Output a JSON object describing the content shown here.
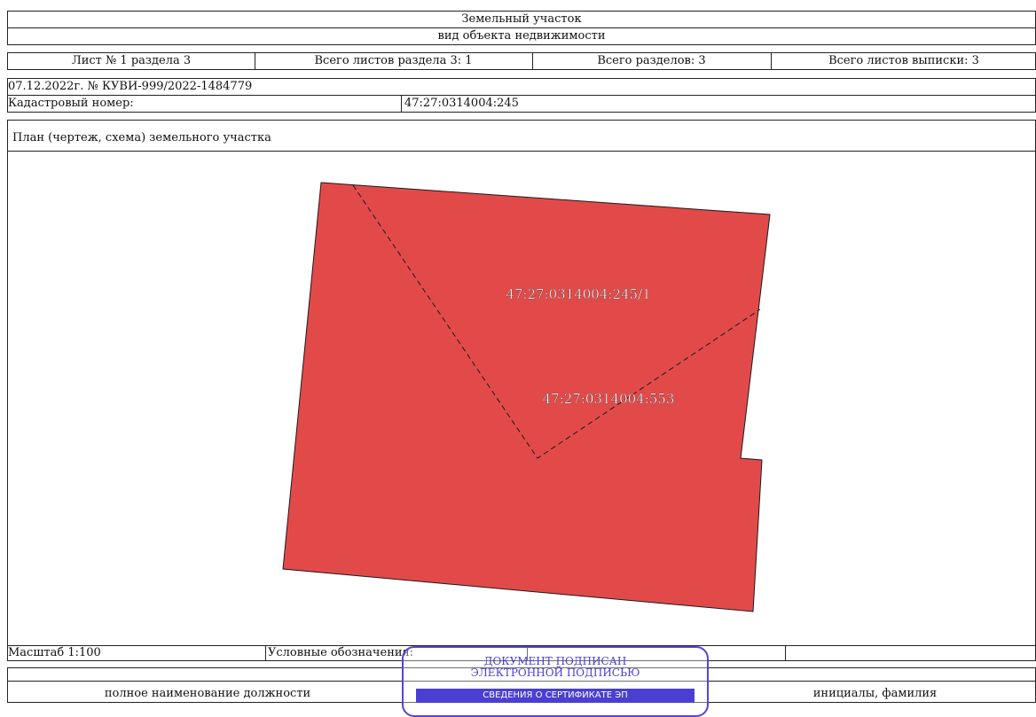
{
  "header": {
    "object_type": "Земельный участок",
    "object_caption": "вид объекта недвижимости"
  },
  "sheet_info": {
    "sheet": "Лист № 1 раздела 3",
    "section_sheets": "Всего листов раздела 3: 1",
    "sections": "Всего разделов: 3",
    "extract_sheets": "Всего листов выписки: 3"
  },
  "record": {
    "date_number": "07.12.2022г. № КУВИ-999/2022-1484779",
    "cadastral_label": "Кадастровый номер:",
    "cadastral_value": "47:27:0314004:245"
  },
  "plan": {
    "title": "План (чертеж, схема) земельного участка",
    "fill_color": "#e24a4a",
    "labels": {
      "part": "47:27:0314004:245/1",
      "building": "47:27:0314004:553"
    }
  },
  "footer": {
    "scale": "Масштаб 1:100",
    "legend": "Условные обозначения:",
    "position_caption": "полное наименование должности",
    "name_caption": "инициалы, фамилия"
  },
  "stamp": {
    "line1": "ДОКУМЕНТ ПОДПИСАН",
    "line2": "ЭЛЕКТРОННОЙ ПОДПИСЬЮ",
    "bar": "СВЕДЕНИЯ О СЕРТИФИКАТЕ ЭП",
    "color": "#4a3fd2"
  }
}
